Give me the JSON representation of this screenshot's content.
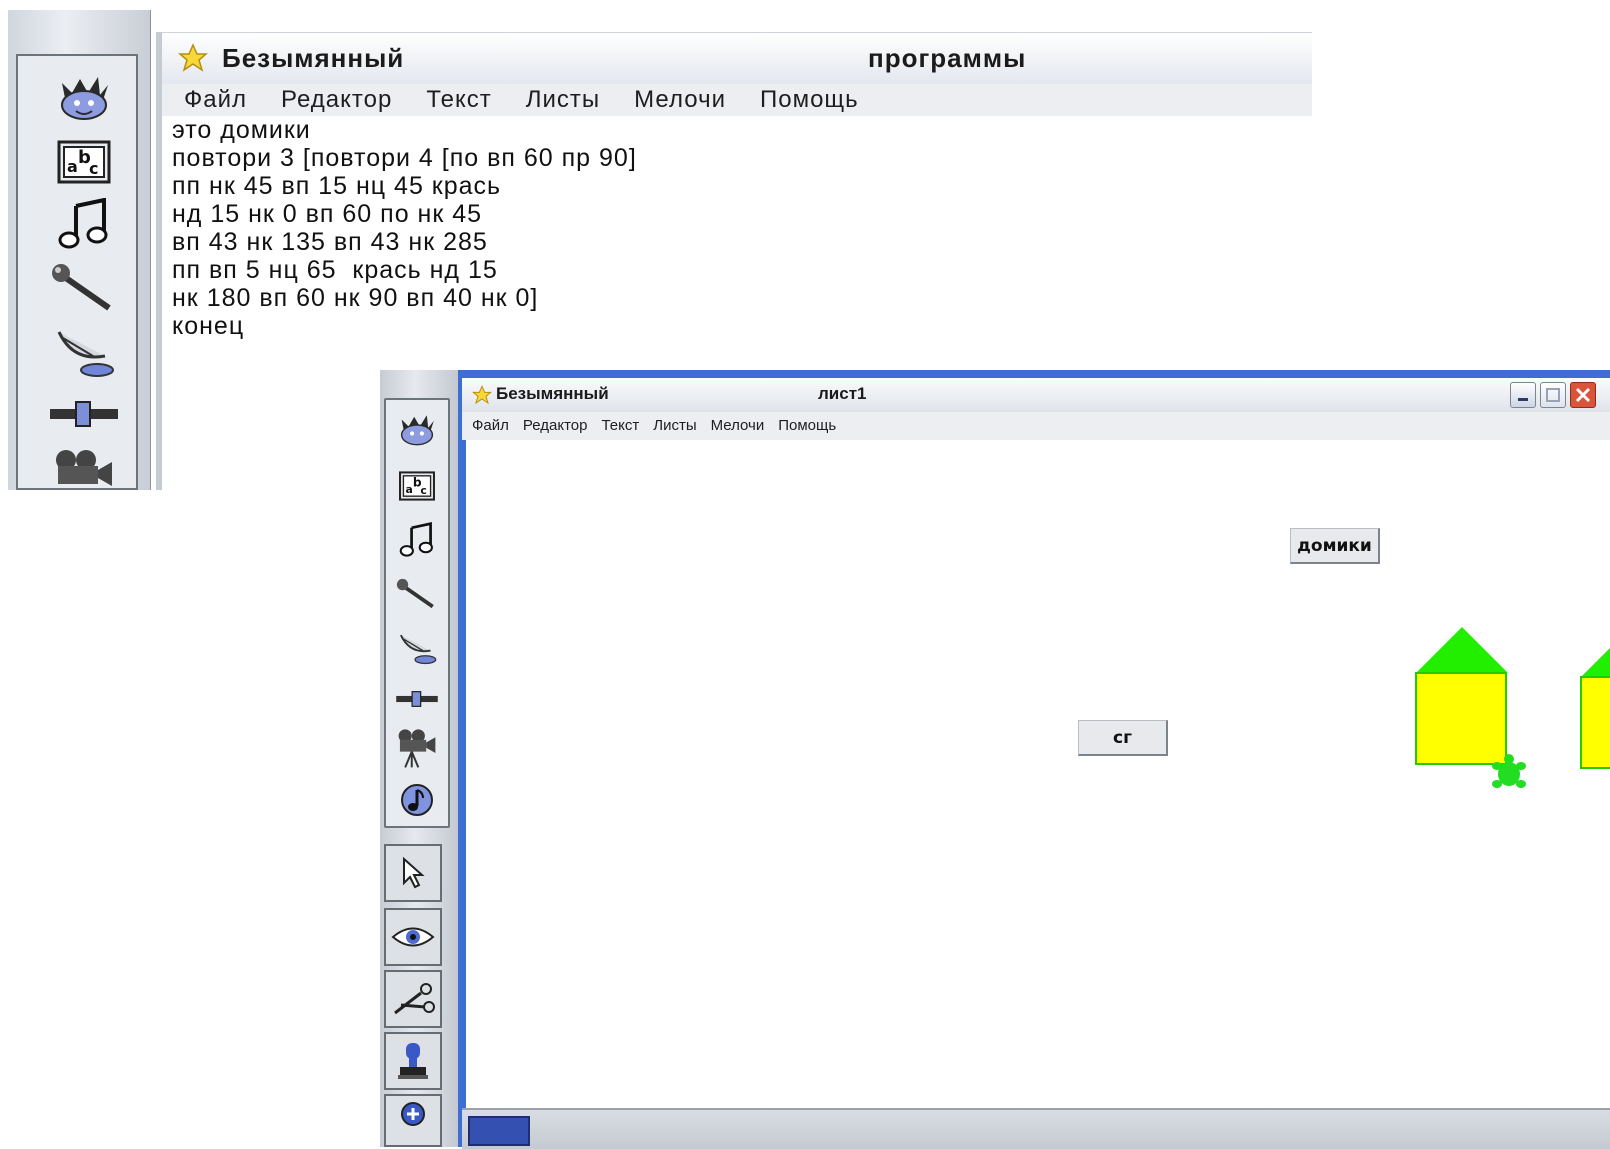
{
  "program_window": {
    "title": "Безымянный",
    "page_title": "программы",
    "menu": [
      "Файл",
      "Редактор",
      "Текст",
      "Листы",
      "Мелочи",
      "Помощь"
    ],
    "code_lines": [
      "это домики",
      "повтори 3 [повтори 4 [по вп 60 пр 90]",
      "пп нк 45 вп 15 нц 45 крась",
      "нд 15 нк 0 вп 60 по нк 45",
      "вп 43 нк 135 вп 43 нк 285",
      "пп вп 5 нц 65  крась нд 15",
      "нк 180 вп 60 нк 90 вп 40 нк 0]",
      "конец"
    ],
    "toolbar_icons": [
      "creatures-icon",
      "text-box-icon",
      "music-icon",
      "microphone-icon",
      "satellite-dish-icon",
      "slider-icon",
      "video-camera-icon"
    ]
  },
  "sheet_window": {
    "title": "Безымянный",
    "page_title": "лист1",
    "menu": [
      "Файл",
      "Редактор",
      "Текст",
      "Листы",
      "Мелочи",
      "Помощь"
    ],
    "canvas_buttons": {
      "domiki": "домики",
      "sg": "сг"
    },
    "houses": [
      {
        "wall_color": "#ffff00",
        "roof_color": "#22ee00"
      },
      {
        "wall_color": "#ffff00",
        "roof_color": "#22ee00"
      },
      {
        "wall_color": "#ffff00",
        "roof_color": "#22ee00"
      }
    ],
    "turtle_color": "#22dd22",
    "toolbar_icons": [
      "creatures-icon",
      "text-box-icon",
      "music-icon",
      "microphone-icon",
      "satellite-dish-icon",
      "slider-icon",
      "video-camera-icon",
      "melody-icon",
      "pointer-icon",
      "eye-icon",
      "scissors-icon",
      "stamp-icon"
    ]
  },
  "colors": {
    "title_frame_blue": "#3c6ed4",
    "close_red": "#d9543a"
  }
}
